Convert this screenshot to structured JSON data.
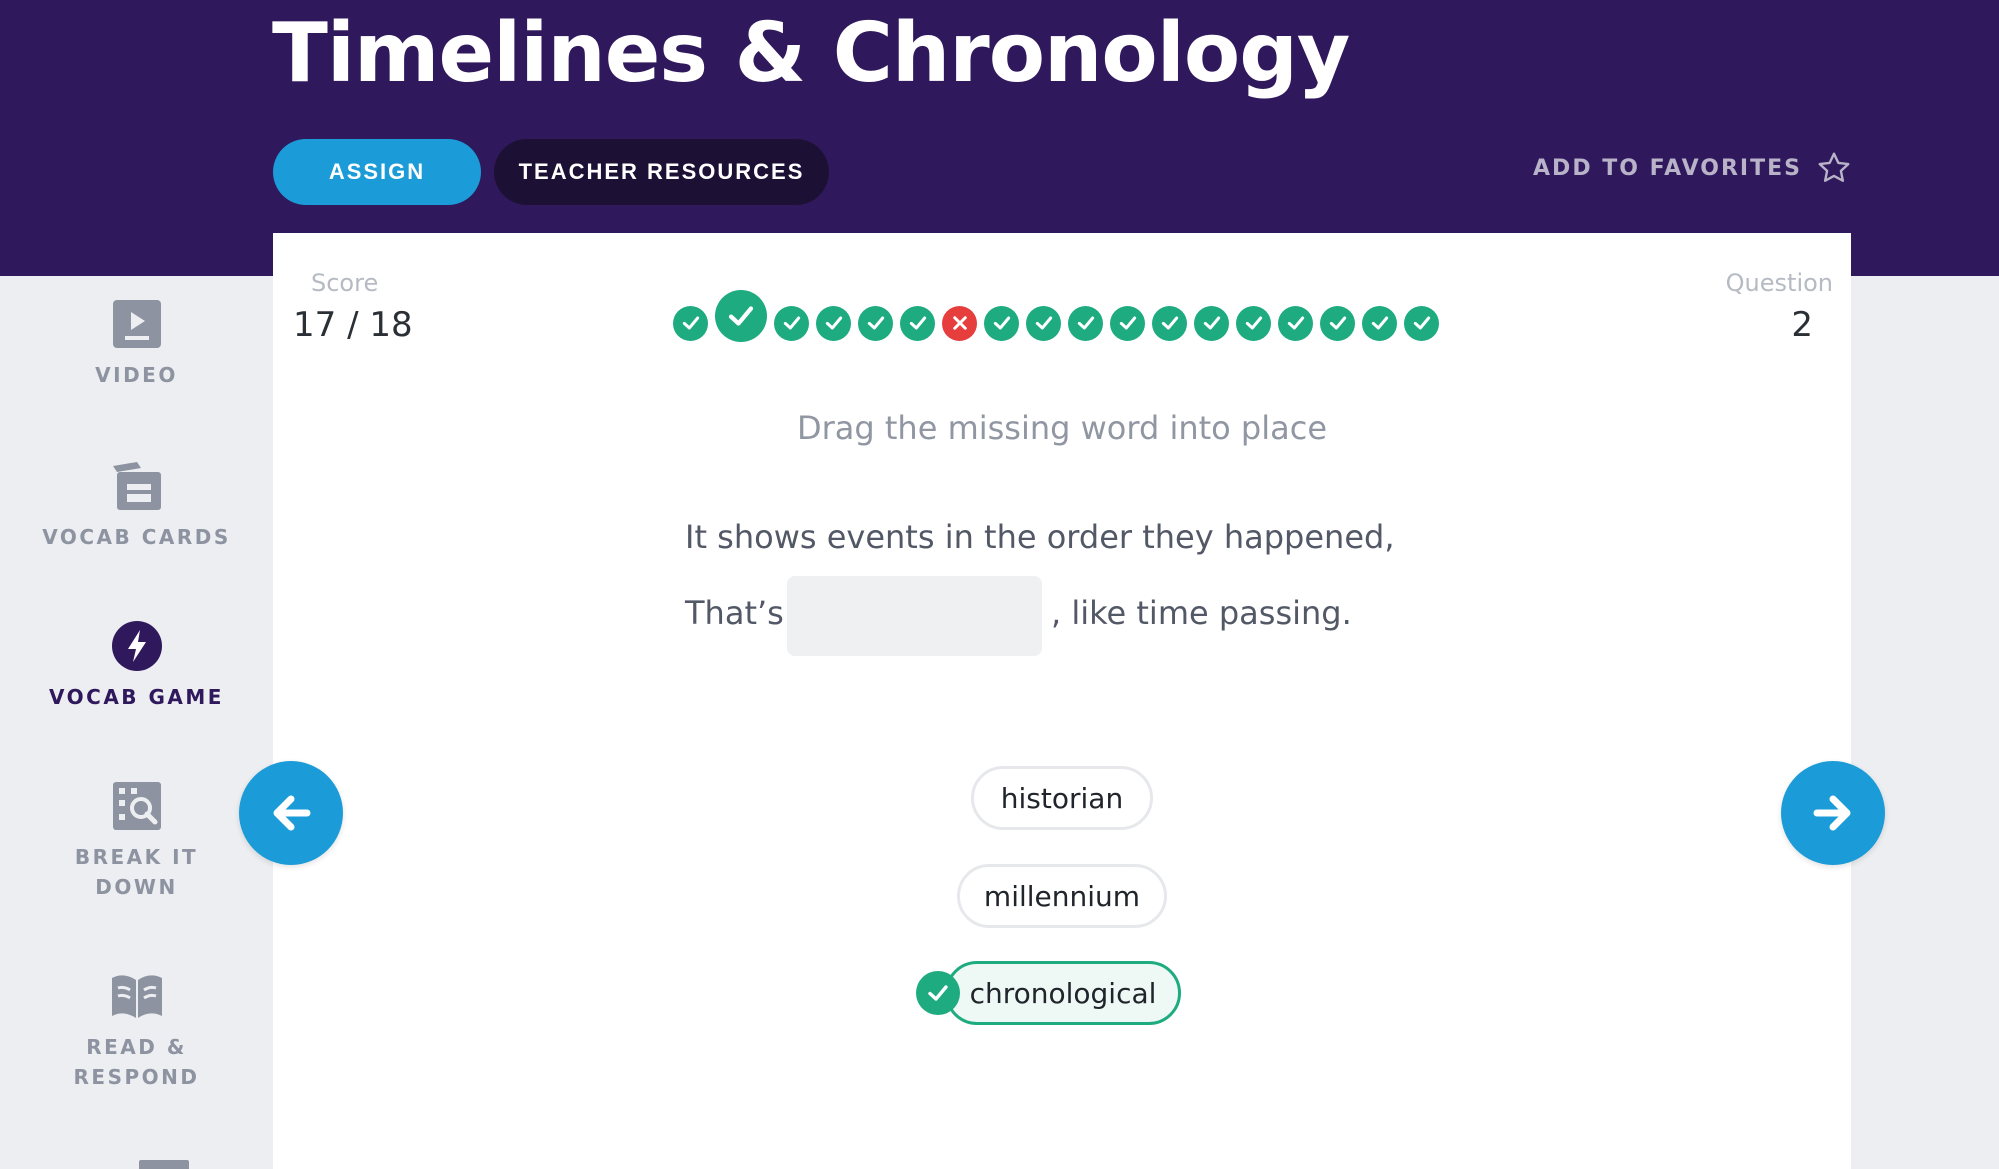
{
  "header": {
    "title": "Timelines & Chronology",
    "assign_label": "ASSIGN",
    "resources_label": "TEACHER RESOURCES",
    "favorites_label": "ADD TO FAVORITES"
  },
  "sidebar": {
    "items": [
      {
        "label": "VIDEO",
        "icon": "video-icon"
      },
      {
        "label": "VOCAB CARDS",
        "icon": "vocab-cards-icon"
      },
      {
        "label": "VOCAB GAME",
        "icon": "lightning-icon",
        "active": true
      },
      {
        "label": "BREAK IT DOWN",
        "line1": "BREAK IT",
        "line2": "DOWN",
        "icon": "break-it-down-icon"
      },
      {
        "label": "READ & RESPOND",
        "line1": "READ &",
        "line2": "RESPOND",
        "icon": "book-icon"
      }
    ]
  },
  "game": {
    "score_label": "Score",
    "score_value": "17 / 18",
    "question_label": "Question",
    "question_value": "2",
    "progress": [
      "correct",
      "correct-current",
      "correct",
      "correct",
      "correct",
      "correct",
      "wrong",
      "correct",
      "correct",
      "correct",
      "correct",
      "correct",
      "correct",
      "correct",
      "correct",
      "correct",
      "correct",
      "correct"
    ],
    "instruction": "Drag the missing word into place",
    "sentence_line1": "It shows events in the order they happened,",
    "sentence_line2_before": "That’s",
    "sentence_line2_after": ", like time passing.",
    "choices": [
      {
        "label": "historian",
        "state": "default"
      },
      {
        "label": "millennium",
        "state": "default"
      },
      {
        "label": "chronological",
        "state": "correct"
      }
    ]
  },
  "colors": {
    "header_bg": "#2f195c",
    "accent_blue": "#1b9bd8",
    "correct_green": "#1eab7f",
    "wrong_red": "#e63d3d"
  }
}
